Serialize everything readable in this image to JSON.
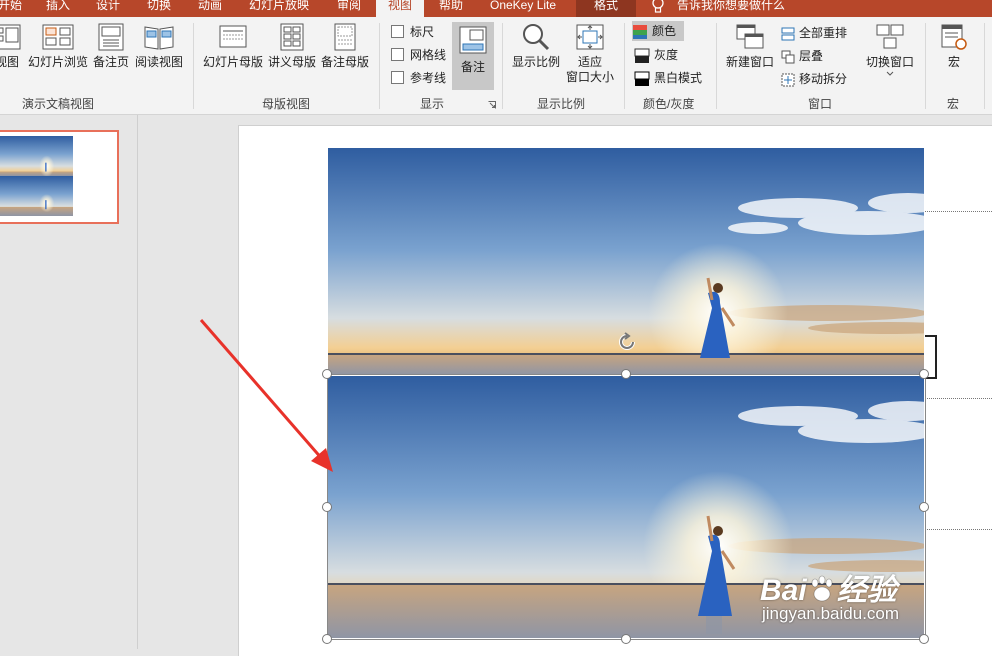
{
  "tabs": [
    "开始",
    "插入",
    "设计",
    "切换",
    "动画",
    "幻灯片放映",
    "审阅",
    "视图",
    "帮助",
    "OneKey Lite",
    "格式"
  ],
  "tell_me": "告诉我你想要做什么",
  "ribbon": {
    "presentation_views": {
      "label": "演示文稿视图",
      "buttons": [
        "视图",
        "幻灯片浏览",
        "备注页",
        "阅读视图"
      ]
    },
    "master_views": {
      "label": "母版视图",
      "buttons": [
        "幻灯片母版",
        "讲义母版",
        "备注母版"
      ]
    },
    "show": {
      "label": "显示",
      "checkboxes": [
        "标尺",
        "网格线",
        "参考线"
      ],
      "notes": "备注"
    },
    "zoom": {
      "label": "显示比例",
      "zoom_btn": "显示比例",
      "fit_btn_line1": "适应",
      "fit_btn_line2": "窗口大小"
    },
    "color": {
      "label": "颜色/灰度",
      "options": [
        "颜色",
        "灰度",
        "黑白模式"
      ]
    },
    "window": {
      "label": "窗口",
      "new_window": "新建窗口",
      "arrange_all": "全部重排",
      "cascade": "层叠",
      "move_split": "移动拆分",
      "switch_windows": "切换窗口"
    },
    "macros": {
      "label": "宏",
      "button": "宏"
    }
  },
  "watermark": {
    "brand": "Bai",
    "brand2": "经验",
    "url": "jingyan.baidu.com"
  },
  "colors": {
    "accent": "#b7472a",
    "thumb_border": "#e8705a",
    "arrow": "#e8322a"
  }
}
